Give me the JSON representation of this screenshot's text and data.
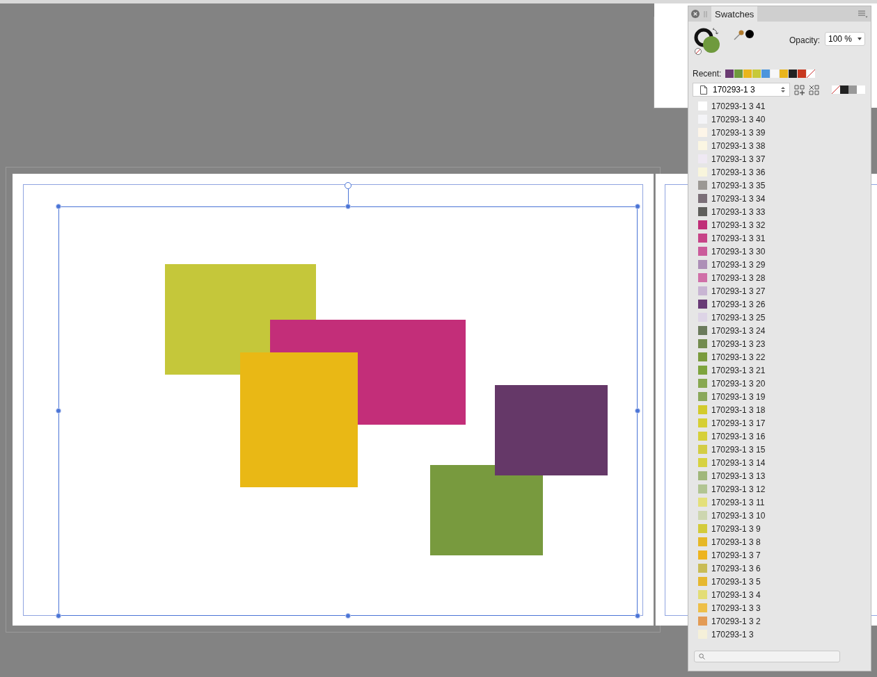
{
  "canvas": {
    "shapes": [
      {
        "color": "#c5c73a"
      },
      {
        "color": "#c32e79"
      },
      {
        "color": "#e9b815"
      },
      {
        "color": "#789a3e"
      },
      {
        "color": "#653868"
      }
    ]
  },
  "panel": {
    "tabs": [
      {
        "label": "Swatches",
        "selected": true
      }
    ],
    "fill": {
      "color": "#6f9a3d"
    },
    "opacity_label": "Opacity:",
    "opacity_value": "100 %",
    "recent_label": "Recent:",
    "recent": [
      {
        "kind": "color",
        "color": "#6a3a72"
      },
      {
        "kind": "color",
        "color": "#6f9a3d"
      },
      {
        "kind": "color",
        "color": "#e9b51c"
      },
      {
        "kind": "color",
        "color": "#c7c93a"
      },
      {
        "kind": "color",
        "color": "#4c95dc"
      },
      {
        "kind": "color",
        "color": "#f7f7f9"
      },
      {
        "kind": "color",
        "color": "#e9b51c"
      },
      {
        "kind": "color",
        "color": "#222222"
      },
      {
        "kind": "color",
        "color": "#c8381f"
      },
      {
        "kind": "none"
      }
    ],
    "palette": "170293-1 3",
    "quick": [
      {
        "kind": "none"
      },
      {
        "kind": "color",
        "color": "#222222"
      },
      {
        "kind": "color",
        "color": "#999999"
      },
      {
        "kind": "color",
        "color": "#ffffff"
      }
    ],
    "swatches": [
      {
        "name": "170293-1 3 41",
        "color": "#ffffff"
      },
      {
        "name": "170293-1 3 40",
        "color": "#f4f4f7"
      },
      {
        "name": "170293-1 3 39",
        "color": "#fdf5e8"
      },
      {
        "name": "170293-1 3 38",
        "color": "#fbf6e2"
      },
      {
        "name": "170293-1 3 37",
        "color": "#efe9f3"
      },
      {
        "name": "170293-1 3 36",
        "color": "#f8f5dc"
      },
      {
        "name": "170293-1 3 35",
        "color": "#9b9894"
      },
      {
        "name": "170293-1 3 34",
        "color": "#7b6f78"
      },
      {
        "name": "170293-1 3 33",
        "color": "#5f5f5c"
      },
      {
        "name": "170293-1 3 32",
        "color": "#c02e78"
      },
      {
        "name": "170293-1 3 31",
        "color": "#c74488"
      },
      {
        "name": "170293-1 3 30",
        "color": "#cb5c9b"
      },
      {
        "name": "170293-1 3 29",
        "color": "#ad8fb7"
      },
      {
        "name": "170293-1 3 28",
        "color": "#d070a8"
      },
      {
        "name": "170293-1 3 27",
        "color": "#c8b5d3"
      },
      {
        "name": "170293-1 3 26",
        "color": "#683a76"
      },
      {
        "name": "170293-1 3 25",
        "color": "#ddd4e6"
      },
      {
        "name": "170293-1 3 24",
        "color": "#6b7b5c"
      },
      {
        "name": "170293-1 3 23",
        "color": "#738c4f"
      },
      {
        "name": "170293-1 3 22",
        "color": "#7a9b3d"
      },
      {
        "name": "170293-1 3 21",
        "color": "#7ea43d"
      },
      {
        "name": "170293-1 3 20",
        "color": "#88a850"
      },
      {
        "name": "170293-1 3 19",
        "color": "#8aa85a"
      },
      {
        "name": "170293-1 3 18",
        "color": "#d3cb2c"
      },
      {
        "name": "170293-1 3 17",
        "color": "#d6cf34"
      },
      {
        "name": "170293-1 3 16",
        "color": "#d6d03a"
      },
      {
        "name": "170293-1 3 15",
        "color": "#d3cd44"
      },
      {
        "name": "170293-1 3 14",
        "color": "#d7d240"
      },
      {
        "name": "170293-1 3 13",
        "color": "#a0b77a"
      },
      {
        "name": "170293-1 3 12",
        "color": "#b1c592"
      },
      {
        "name": "170293-1 3 11",
        "color": "#e4e07a"
      },
      {
        "name": "170293-1 3 10",
        "color": "#cdd6b0"
      },
      {
        "name": "170293-1 3 9",
        "color": "#d3cb3b"
      },
      {
        "name": "170293-1 3 8",
        "color": "#e6b827"
      },
      {
        "name": "170293-1 3 7",
        "color": "#edb41f"
      },
      {
        "name": "170293-1 3 6",
        "color": "#c9bc56"
      },
      {
        "name": "170293-1 3 5",
        "color": "#e6b830"
      },
      {
        "name": "170293-1 3 4",
        "color": "#e3dd75"
      },
      {
        "name": "170293-1 3 3",
        "color": "#eebf48"
      },
      {
        "name": "170293-1 3 2",
        "color": "#e39b55"
      },
      {
        "name": "170293-1 3",
        "color": "#f5f0d9"
      }
    ]
  }
}
